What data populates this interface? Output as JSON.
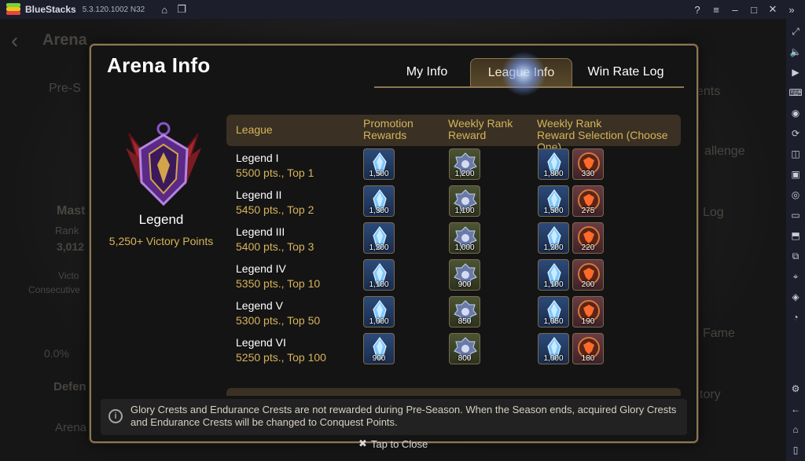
{
  "app": {
    "name": "BlueStacks",
    "version": "5.3.120.1002 N32"
  },
  "modal": {
    "title": "Arena Info",
    "tabs": [
      {
        "label": "My Info",
        "active": false
      },
      {
        "label": "League Info",
        "active": true
      },
      {
        "label": "Win Rate Log",
        "active": false
      }
    ]
  },
  "current_league": {
    "name": "Legend",
    "points": "5,250+ Victory Points"
  },
  "table": {
    "headers": {
      "league": "League",
      "promotion": [
        "Promotion",
        "Rewards"
      ],
      "weekly": [
        "Weekly Rank",
        "Reward"
      ],
      "selection": [
        "Weekly Rank",
        "Reward Selection (Choose One)"
      ]
    },
    "rows": [
      {
        "name": "Legend I",
        "req": "5500 pts., Top 1",
        "promo": "1,500",
        "weekly": "1,200",
        "choice_a": "1,800",
        "choice_b": "330"
      },
      {
        "name": "Legend II",
        "req": "5450 pts., Top 2",
        "promo": "1,300",
        "weekly": "1,100",
        "choice_a": "1,500",
        "choice_b": "275"
      },
      {
        "name": "Legend III",
        "req": "5400 pts., Top 3",
        "promo": "1,200",
        "weekly": "1,000",
        "choice_a": "1,200",
        "choice_b": "220"
      },
      {
        "name": "Legend IV",
        "req": "5350 pts., Top 10",
        "promo": "1,100",
        "weekly": "900",
        "choice_a": "1,100",
        "choice_b": "200"
      },
      {
        "name": "Legend V",
        "req": "5300 pts., Top 50",
        "promo": "1,000",
        "weekly": "850",
        "choice_a": "1,050",
        "choice_b": "190"
      },
      {
        "name": "Legend VI",
        "req": "5250 pts., Top 100",
        "promo": "900",
        "weekly": "800",
        "choice_a": "1,000",
        "choice_b": "180"
      }
    ]
  },
  "notice": "Glory Crests and Endurance Crests are not rewarded during Pre-Season. When the Season ends, acquired Glory Crests and Endurance Crests will be changed to Conquest Points.",
  "close_label": "Tap to Close",
  "background": {
    "arena": "Arena",
    "preseason": "Pre-S",
    "mast": "Mast",
    "rank": "Rank",
    "rank_value": "3,012",
    "victo": "Victo",
    "consecutive": "Consecutive",
    "percent": "0.0%",
    "defen": "Defen",
    "arena_info": "Arena Info",
    "ents": "ents",
    "allenge": "allenge",
    "log": "Log",
    "fame": "Fame",
    "tory": "tory"
  },
  "colors": {
    "gold_text": "#d7b35a",
    "frame": "#8c7752",
    "header_bg": "#3a3124"
  }
}
